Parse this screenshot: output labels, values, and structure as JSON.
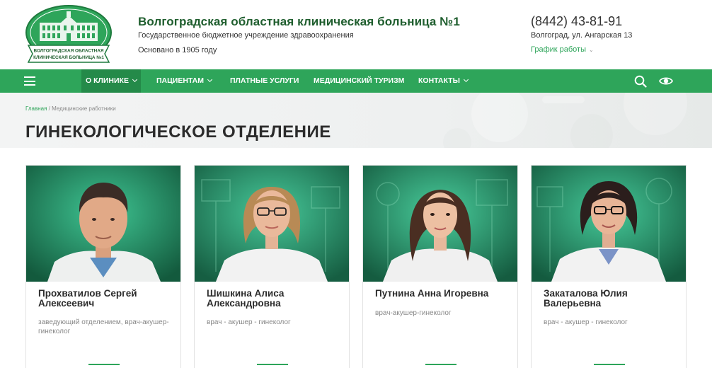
{
  "header": {
    "title": "Волгоградская областная клиническая больница №1",
    "subtitle": "Государственное бюджетное учреждение здравоохранения",
    "founded": "Основано в 1905 году",
    "phone": "(8442) 43-81-91",
    "address": "Волгоград, ул. Ангарская 13",
    "schedule": "График работы",
    "logo_text_1": "ВОЛГОГРАДСКАЯ ОБЛАСТНАЯ",
    "logo_text_2": "КЛИНИЧЕСКАЯ БОЛЬНИЦА №1"
  },
  "nav": {
    "items": [
      {
        "label": "О КЛИНИКЕ",
        "dropdown": true,
        "active": true
      },
      {
        "label": "ПАЦИЕНТАМ",
        "dropdown": true,
        "active": false
      },
      {
        "label": "ПЛАТНЫЕ УСЛУГИ",
        "dropdown": false,
        "active": false
      },
      {
        "label": "МЕДИЦИНСКИЙ ТУРИЗМ",
        "dropdown": false,
        "active": false
      },
      {
        "label": "КОНТАКТЫ",
        "dropdown": true,
        "active": false
      }
    ],
    "icons": [
      "menu-icon",
      "search-icon",
      "eye-icon"
    ]
  },
  "breadcrumb": {
    "home": "Главная",
    "separator": " / ",
    "current": "Медицинские работники"
  },
  "page_title": "ГИНЕКОЛОГИЧЕСКОЕ ОТДЕЛЕНИЕ",
  "doctors": [
    {
      "name": "Прохватилов Сергей Алексеевич",
      "role": "заведующий отделением, врач-акушер-гинеколог"
    },
    {
      "name": "Шишкина Алиса Александровна",
      "role": "врач - акушер - гинеколог"
    },
    {
      "name": "Путнина Анна Игоревна",
      "role": "врач-акушер-гинеколог"
    },
    {
      "name": "Закаталова Юлия Валерьевна",
      "role": "врач - акушер - гинеколог"
    }
  ],
  "colors": {
    "brand_green": "#2ea55a",
    "nav_active": "#248a49",
    "title_green": "#1f5e2e"
  }
}
